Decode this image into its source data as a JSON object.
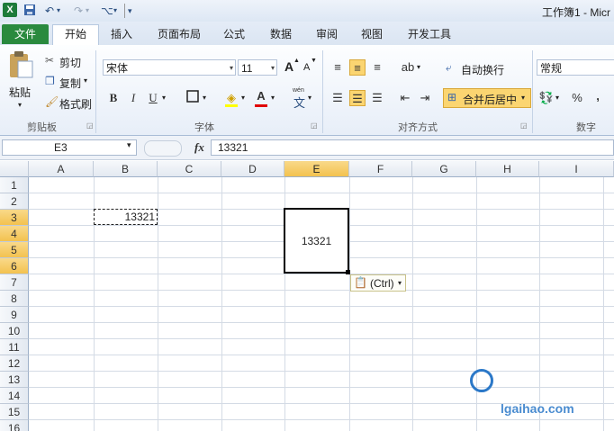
{
  "titlebar": {
    "title": "工作簿1 - Micr",
    "excel_icon": "X",
    "undo": "↶",
    "redo": "↷",
    "custom": "⌥"
  },
  "tabs": [
    "文件",
    "开始",
    "插入",
    "页面布局",
    "公式",
    "数据",
    "审阅",
    "视图",
    "开发工具"
  ],
  "ribbon": {
    "clipboard": {
      "paste": "粘贴",
      "cut": "剪切",
      "copy": "复制",
      "format_painter": "格式刷",
      "label": "剪贴板"
    },
    "font": {
      "name": "宋体",
      "size": "11",
      "grow": "A",
      "shrink": "A",
      "bold": "B",
      "italic": "I",
      "underline": "U",
      "phonetic": "wén",
      "label": "字体"
    },
    "alignment": {
      "wrap_text": "自动换行",
      "merge_center": "合并后居中",
      "label": "对齐方式"
    },
    "number": {
      "format": "常规",
      "percent": "%",
      "comma": ",",
      "label": "数字"
    }
  },
  "formula_bar": {
    "name_box": "E3",
    "fx": "fx",
    "value": "13321"
  },
  "grid": {
    "columns": [
      "A",
      "B",
      "C",
      "D",
      "E",
      "F",
      "G",
      "H",
      "I"
    ],
    "rows": [
      "1",
      "2",
      "3",
      "4",
      "5",
      "6",
      "7",
      "8",
      "9",
      "10",
      "11",
      "12",
      "13",
      "14",
      "15",
      "16"
    ],
    "selected_column": "E",
    "selected_rows": [
      "3",
      "4",
      "5",
      "6"
    ],
    "copied_cell": {
      "ref": "B3",
      "value": "13321"
    },
    "merged_cell": {
      "ref": "E3:E6",
      "value": "13321"
    }
  },
  "paste_options": {
    "label": "(Ctrl)"
  },
  "watermark": {
    "text": "lgaihao.com"
  },
  "colors": {
    "file_tab": "#2a8a3e",
    "selection": "#f3c24f",
    "active_border": "#000000"
  }
}
